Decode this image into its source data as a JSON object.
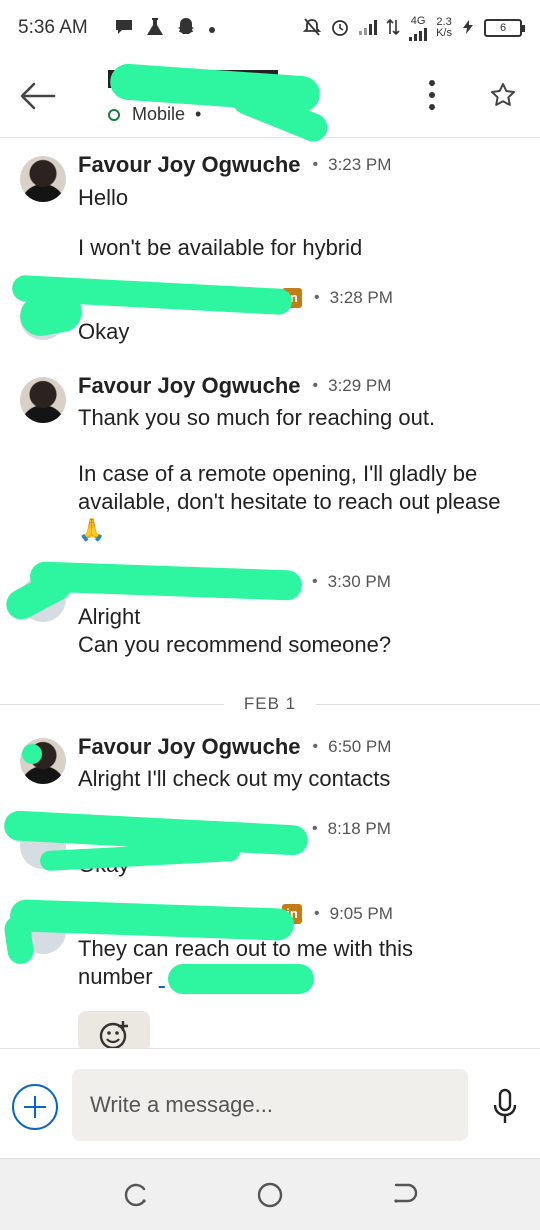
{
  "status_bar": {
    "time": "5:36 AM",
    "network_type": "4G",
    "speed_value": "2.3",
    "speed_unit": "K/s",
    "battery": "6",
    "icons": [
      "message-bubble-icon",
      "flask-icon",
      "snapchat-ghost-icon",
      "dot-icon",
      "mute-bell-icon",
      "alarm-clock-icon",
      "signal-icon",
      "data-arrows-icon",
      "signal-4g-icon",
      "charging-icon",
      "battery-icon"
    ]
  },
  "header": {
    "presence_label": "Mobile",
    "icons": [
      "back-arrow-icon",
      "vertical-dots-icon",
      "star-icon"
    ]
  },
  "conversation": {
    "messages": [
      {
        "sender": "Favour Joy Ogwuche",
        "time": "3:23 PM",
        "lines": [
          "Hello",
          "",
          "I won't be available for hybrid"
        ]
      },
      {
        "sender": "",
        "badge": "in",
        "time": "3:28 PM",
        "lines": [
          "Okay"
        ]
      },
      {
        "sender": "Favour Joy Ogwuche",
        "time": "3:29 PM",
        "lines": [
          "Thank you so much for reaching out.",
          "",
          "In case of a remote opening, I'll gladly be available, don't hesitate to reach out please 🙏"
        ]
      },
      {
        "sender": "",
        "time": "3:30 PM",
        "lines": [
          "Alright",
          "Can you recommend someone?"
        ]
      },
      {
        "sender": "Favour Joy Ogwuche",
        "time": "6:50 PM",
        "lines": [
          "Alright I'll check out my contacts"
        ]
      },
      {
        "sender": "",
        "time": "8:18 PM",
        "lines": [
          "Okay"
        ]
      },
      {
        "sender": "",
        "badge": "in",
        "time": "9:05 PM",
        "lines": [
          "They can reach out to me with this",
          "number"
        ]
      }
    ],
    "date_divider": "FEB 1"
  },
  "compose": {
    "placeholder": "Write a message..."
  },
  "colors": {
    "accent": "#0a66c2",
    "presence_green": "#1a7f3c",
    "redaction": "#2ef5a0",
    "linkedin_badge": "#c37d16"
  }
}
